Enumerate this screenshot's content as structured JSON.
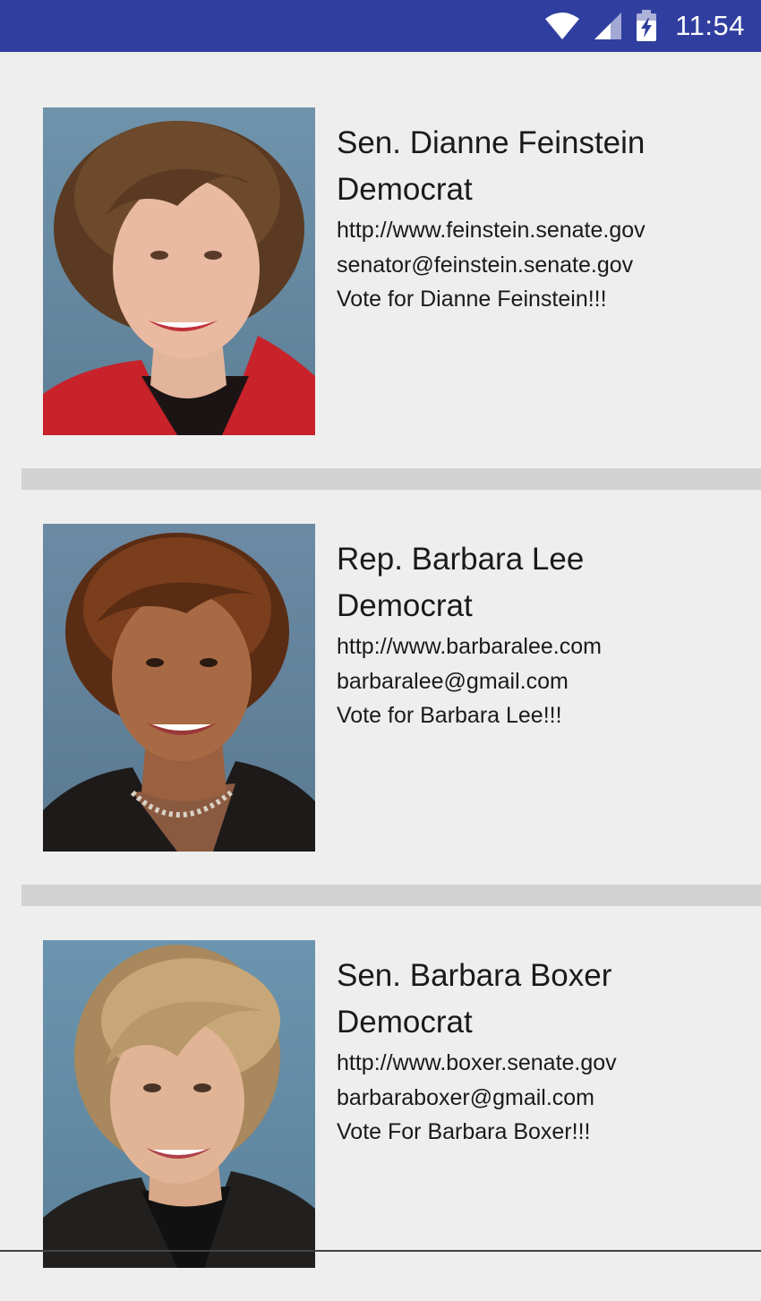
{
  "status_bar": {
    "time": "11:54",
    "background": "#303f9f",
    "icons": [
      "wifi-icon",
      "cell-signal-icon",
      "battery-charging-icon"
    ]
  },
  "representatives": [
    {
      "name": "Sen. Dianne Feinstein",
      "party": "Democrat",
      "website": "http://www.feinstein.senate.gov",
      "email": "senator@feinstein.senate.gov",
      "slogan": "Vote for Dianne Feinstein!!!",
      "photo_alt": "Portrait of Dianne Feinstein"
    },
    {
      "name": "Rep. Barbara Lee",
      "party": "Democrat",
      "website": "http://www.barbaralee.com",
      "email": "barbaralee@gmail.com",
      "slogan": "Vote for Barbara Lee!!!",
      "photo_alt": "Portrait of Barbara Lee"
    },
    {
      "name": "Sen. Barbara Boxer",
      "party": "Democrat",
      "website": "http://www.boxer.senate.gov",
      "email": "barbaraboxer@gmail.com",
      "slogan": "Vote For Barbara Boxer!!!",
      "photo_alt": "Portrait of Barbara Boxer"
    }
  ],
  "colors": {
    "background": "#eeeeee",
    "divider": "#d2d2d2",
    "text": "#1a1a1a",
    "photo_backdrop": "#6a8fa8"
  }
}
